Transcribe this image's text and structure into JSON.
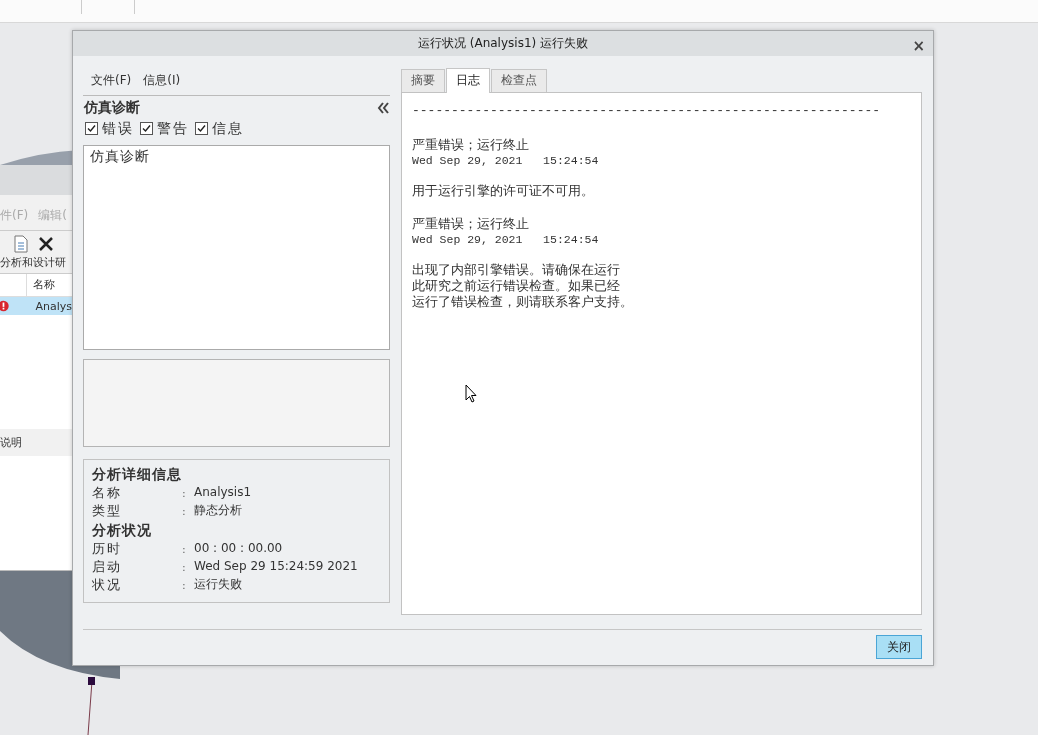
{
  "background_window": {
    "menu": [
      "件(F)",
      "编辑("
    ],
    "toolbar_label": "分析和设计研",
    "table": {
      "columns": [
        "名称"
      ],
      "rows": [
        {
          "name": "Analys",
          "selected": true
        }
      ]
    },
    "section_label": "说明"
  },
  "dialog": {
    "title": "运行状况 (Analysis1) 运行失败",
    "menu": [
      "文件(F)",
      "信息(I)"
    ],
    "diagnostics": {
      "title": "仿真诊断",
      "filters": [
        {
          "label": "错误",
          "checked": true
        },
        {
          "label": "警告",
          "checked": true
        },
        {
          "label": "信息",
          "checked": true
        }
      ],
      "items": [
        "仿真诊断"
      ]
    },
    "details": [
      {
        "heading": "分析详细信息",
        "rows": [
          {
            "label": "名称",
            "sep": ":",
            "value": "Analysis1"
          },
          {
            "label": "类型",
            "sep": ":",
            "value": "静态分析"
          }
        ]
      },
      {
        "heading": "分析状况",
        "rows": [
          {
            "label": "历时",
            "sep": ":",
            "value": "00 : 00 : 00.00"
          },
          {
            "label": "启动",
            "sep": ":",
            "value": "Wed Sep 29 15:24:59 2021"
          },
          {
            "label": "状况",
            "sep": ":",
            "value": "运行失败"
          }
        ]
      }
    ],
    "tabs": [
      {
        "label": "摘要",
        "selected": false
      },
      {
        "label": "日志",
        "selected": true
      },
      {
        "label": "检查点",
        "selected": false
      }
    ],
    "log": [
      {
        "kind": "rule",
        "text": "------------------------------------------------------------"
      },
      {
        "kind": "entry",
        "title": "严重错误；运行终止",
        "time": "Wed Sep 29, 2021   15:24:54"
      },
      {
        "kind": "message",
        "text": "用于运行引擎的许可证不可用。"
      },
      {
        "kind": "entry",
        "title": "严重错误；运行终止",
        "time": "Wed Sep 29, 2021   15:24:54"
      },
      {
        "kind": "lines",
        "lines": [
          "出现了内部引擎错误。请确保在运行",
          "此研究之前运行错误检查。如果已经",
          "运行了错误检查，则请联系客户支持。"
        ]
      }
    ],
    "close_glyph": "×",
    "buttons": [
      "关闭"
    ]
  }
}
